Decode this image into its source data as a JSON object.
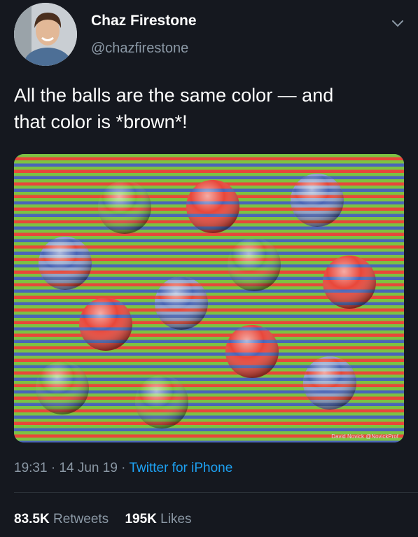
{
  "author": {
    "name": "Chaz Firestone",
    "handle": "@chazfirestone"
  },
  "tweet": {
    "text_line1": "All the balls are the same color — and",
    "text_line2": "that color is *brown*!",
    "image_credit": "David Novick @NovickProf"
  },
  "meta": {
    "time": "19:31",
    "sep1": " · ",
    "date": "14 Jun 19",
    "sep2": " · ",
    "source": "Twitter for iPhone"
  },
  "stats": {
    "retweets_count": "83.5K",
    "retweets_label": "Retweets",
    "likes_count": "195K",
    "likes_label": "Likes"
  },
  "icons": {
    "menu": "chevron-down-icon"
  },
  "colors": {
    "background": "#15181f",
    "secondary_text": "#8b98a5",
    "link": "#1da1f2",
    "ball_green": "#7dc242",
    "ball_red": "#e8473a",
    "ball_blue": "#8fa3c8"
  }
}
